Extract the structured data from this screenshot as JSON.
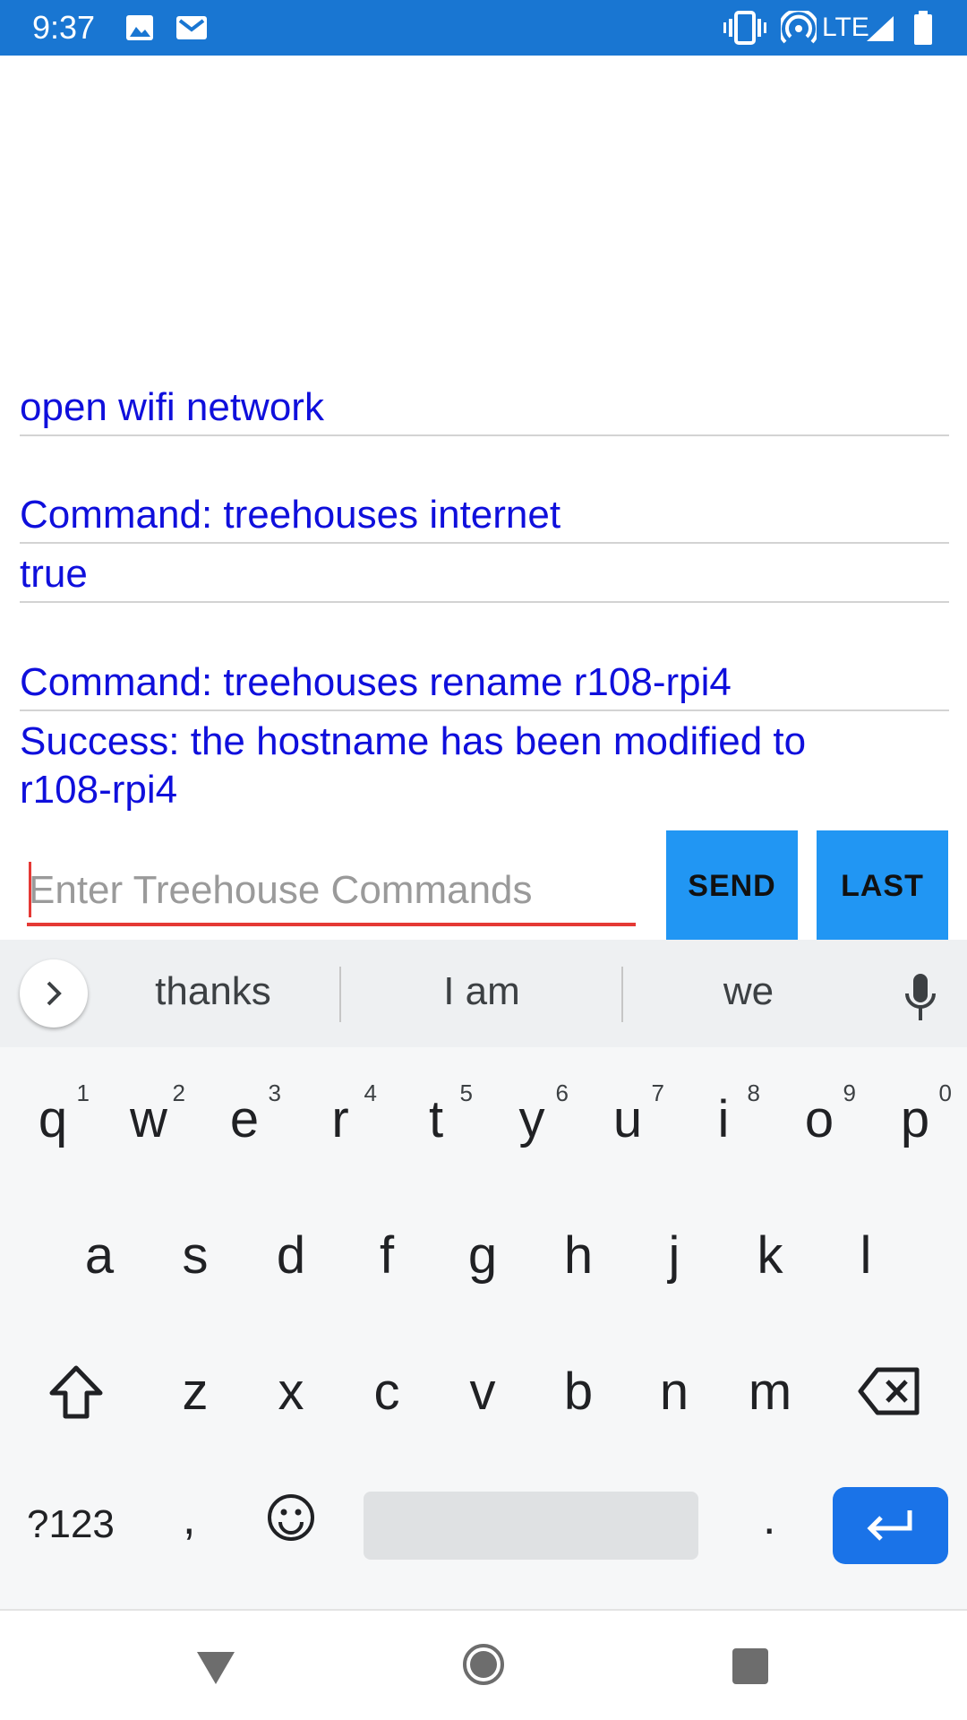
{
  "status_bar": {
    "time": "9:37",
    "network": "LTE",
    "icons": [
      "photo-icon",
      "gmail-icon",
      "vibrate-icon",
      "hotspot-icon",
      "signal-icon",
      "battery-icon"
    ],
    "background": "#1976d2"
  },
  "console": {
    "lines": [
      "open wifi network",
      "Command:  treehouses internet",
      "true",
      "Command:  treehouses rename r108-rpi4",
      "Success: the hostname has been modified to r108-rpi4"
    ],
    "text_color": "#0f0fdc"
  },
  "command_input": {
    "value": "",
    "placeholder": "Enter Treehouse Commands"
  },
  "buttons": {
    "send": "SEND",
    "last": "LAST",
    "color": "#2196f3"
  },
  "keyboard": {
    "suggestions": [
      "thanks",
      "I am",
      "we"
    ],
    "row1": [
      {
        "letter": "q",
        "hint": "1"
      },
      {
        "letter": "w",
        "hint": "2"
      },
      {
        "letter": "e",
        "hint": "3"
      },
      {
        "letter": "r",
        "hint": "4"
      },
      {
        "letter": "t",
        "hint": "5"
      },
      {
        "letter": "y",
        "hint": "6"
      },
      {
        "letter": "u",
        "hint": "7"
      },
      {
        "letter": "i",
        "hint": "8"
      },
      {
        "letter": "o",
        "hint": "9"
      },
      {
        "letter": "p",
        "hint": "0"
      }
    ],
    "row2": [
      "a",
      "s",
      "d",
      "f",
      "g",
      "h",
      "j",
      "k",
      "l"
    ],
    "row3": [
      "z",
      "x",
      "c",
      "v",
      "b",
      "n",
      "m"
    ],
    "symbols_label": "?123",
    "comma": ",",
    "period": ".",
    "enter_color": "#1a73e8"
  },
  "nav_bar": {
    "icons": [
      "back-icon",
      "home-icon",
      "recents-icon"
    ]
  }
}
